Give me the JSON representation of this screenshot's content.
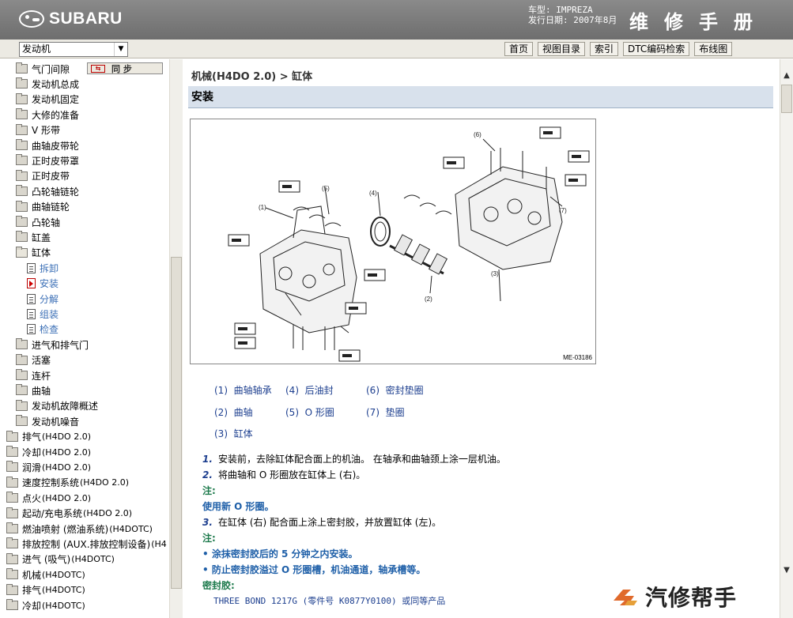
{
  "header": {
    "brand": "SUBARU",
    "model_line": "车型: IMPREZA",
    "date_line": "发行日期: 2007年8月",
    "manual_title": "维修手册"
  },
  "toolbar": {
    "section_select": "发动机",
    "nav": [
      "首页",
      "视图目录",
      "索引",
      "DTC编码检索",
      "布线图"
    ]
  },
  "sidebar": {
    "sync_label": "同 步",
    "sync_icon_text": "⇆",
    "items": [
      {
        "label": "气门间隙",
        "indent": 1,
        "kind": "folder"
      },
      {
        "label": "发动机总成",
        "indent": 1,
        "kind": "folder"
      },
      {
        "label": "发动机固定",
        "indent": 1,
        "kind": "folder"
      },
      {
        "label": "大修的准备",
        "indent": 1,
        "kind": "folder"
      },
      {
        "label": "V 形带",
        "indent": 1,
        "kind": "folder"
      },
      {
        "label": "曲轴皮带轮",
        "indent": 1,
        "kind": "folder"
      },
      {
        "label": "正时皮带罩",
        "indent": 1,
        "kind": "folder"
      },
      {
        "label": "正时皮带",
        "indent": 1,
        "kind": "folder"
      },
      {
        "label": "凸轮轴链轮",
        "indent": 1,
        "kind": "folder"
      },
      {
        "label": "曲轴链轮",
        "indent": 1,
        "kind": "folder"
      },
      {
        "label": "凸轮轴",
        "indent": 1,
        "kind": "folder"
      },
      {
        "label": "缸盖",
        "indent": 1,
        "kind": "folder"
      },
      {
        "label": "缸体",
        "indent": 1,
        "kind": "folder-open"
      },
      {
        "label": "拆卸",
        "indent": 2,
        "kind": "doc"
      },
      {
        "label": "安装",
        "indent": 2,
        "kind": "doc-active"
      },
      {
        "label": "分解",
        "indent": 2,
        "kind": "doc"
      },
      {
        "label": "组装",
        "indent": 2,
        "kind": "doc"
      },
      {
        "label": "检查",
        "indent": 2,
        "kind": "doc"
      },
      {
        "label": "进气和排气门",
        "indent": 1,
        "kind": "folder"
      },
      {
        "label": "活塞",
        "indent": 1,
        "kind": "folder"
      },
      {
        "label": "连杆",
        "indent": 1,
        "kind": "folder"
      },
      {
        "label": "曲轴",
        "indent": 1,
        "kind": "folder"
      },
      {
        "label": "发动机故障概述",
        "indent": 1,
        "kind": "folder"
      },
      {
        "label": "发动机噪音",
        "indent": 1,
        "kind": "folder"
      },
      {
        "label": "排气",
        "sub": "(H4DO 2.0)",
        "indent": 0,
        "kind": "folder"
      },
      {
        "label": "冷却",
        "sub": "(H4DO 2.0)",
        "indent": 0,
        "kind": "folder"
      },
      {
        "label": "润滑",
        "sub": "(H4DO 2.0)",
        "indent": 0,
        "kind": "folder"
      },
      {
        "label": "速度控制系统",
        "sub": "(H4DO 2.0)",
        "indent": 0,
        "kind": "folder"
      },
      {
        "label": "点火",
        "sub": "(H4DO 2.0)",
        "indent": 0,
        "kind": "folder"
      },
      {
        "label": "起动/充电系统",
        "sub": "(H4DO 2.0)",
        "indent": 0,
        "kind": "folder"
      },
      {
        "label": "燃油喷射 (燃油系统)",
        "sub": "(H4DOTC)",
        "indent": 0,
        "kind": "folder"
      },
      {
        "label": "排放控制 (AUX.排放控制设备)",
        "sub": "(H4",
        "indent": 0,
        "kind": "folder"
      },
      {
        "label": "进气 (吸气)",
        "sub": "(H4DOTC)",
        "indent": 0,
        "kind": "folder"
      },
      {
        "label": "机械",
        "sub": "(H4DOTC)",
        "indent": 0,
        "kind": "folder"
      },
      {
        "label": "排气",
        "sub": "(H4DOTC)",
        "indent": 0,
        "kind": "folder"
      },
      {
        "label": "冷却",
        "sub": "(H4DOTC)",
        "indent": 0,
        "kind": "folder"
      }
    ]
  },
  "main": {
    "breadcrumb": "机械(H4DO 2.0) > 缸体",
    "section_title": "安装",
    "figure_id": "ME-03186",
    "figure_callouts": [
      "(1)",
      "(2)",
      "(3)",
      "(4)",
      "(5)",
      "(6)",
      "(7)"
    ],
    "legend": [
      [
        "(1)  曲轴轴承",
        "(4)  后油封",
        "(6)  密封垫圈"
      ],
      [
        "(2)  曲轴",
        "(5)  O 形圈",
        "(7)  垫圈"
      ],
      [
        "(3)  缸体"
      ]
    ],
    "steps": [
      {
        "type": "step",
        "num": "1.",
        "text": "安装前，去除缸体配合面上的机油。 在轴承和曲轴颈上涂一层机油。"
      },
      {
        "type": "step",
        "num": "2.",
        "text": "将曲轴和 O 形圈放在缸体上 (右)。"
      },
      {
        "type": "note-label",
        "text": "注:"
      },
      {
        "type": "note",
        "text": "使用新 O 形圈。"
      },
      {
        "type": "step",
        "num": "3.",
        "text": "在缸体 (右) 配合面上涂上密封胶，并放置缸体 (左)。"
      },
      {
        "type": "note-label",
        "text": "注:"
      },
      {
        "type": "bullet",
        "text": "• 涂抹密封胶后的 5 分钟之内安装。"
      },
      {
        "type": "bullet",
        "text": "• 防止密封胶溢过 O 形圈槽，机油通道，轴承槽等。"
      },
      {
        "type": "sealant-label",
        "text": "密封胶:"
      },
      {
        "type": "sealant",
        "text": "THREE BOND 1217G (零件号 K0877Y0100) 或同等产品"
      }
    ]
  },
  "watermark": "汽修帮手",
  "colors": {
    "header_bg": "#7a7a7a",
    "link_blue": "#1d3f8f",
    "note_green": "#1d7a4c",
    "section_bar": "#d8e1ec"
  }
}
